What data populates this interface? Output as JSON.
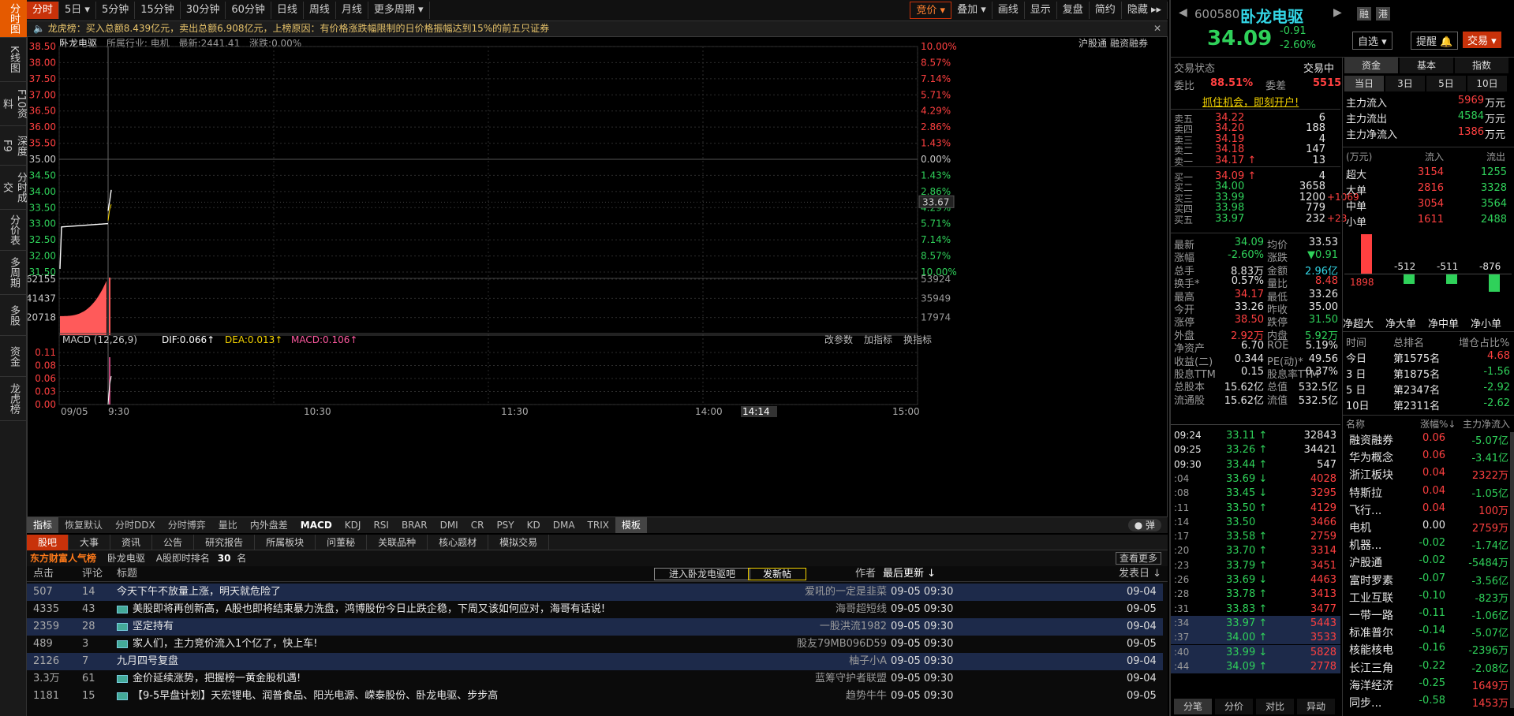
{
  "left_tabs": [
    "分时图",
    "K线图",
    "F10资料",
    "深度F9",
    "分时成交",
    "分价表",
    "多周期",
    "多股",
    "资金",
    "龙虎榜"
  ],
  "toolbar": {
    "items": [
      "分时",
      "5日",
      "5分钟",
      "15分钟",
      "30分钟",
      "60分钟",
      "日线",
      "周线",
      "月线",
      "更多周期"
    ],
    "right_items": [
      "竞价",
      "叠加",
      "画线",
      "显示",
      "复盘",
      "简约",
      "隐藏"
    ]
  },
  "notice": "龙虎榜：买入总额8.439亿元，卖出总额6.908亿元，上榜原因：有价格涨跌幅限制的日价格振幅达到15%的前五只证券",
  "chart_header": {
    "name": "卧龙电驱",
    "industry_label": "所属行业: 电机",
    "latest_label": "最新:2441.41",
    "change_label": "涨跌:0.00%",
    "right1": "沪股通",
    "right2": "融资融券"
  },
  "price_axis": {
    "left": [
      "38.50",
      "38.00",
      "37.50",
      "37.00",
      "36.50",
      "36.00",
      "35.50",
      "35.00",
      "34.50",
      "34.00",
      "33.50",
      "33.00",
      "32.50",
      "32.00",
      "31.50"
    ],
    "right": [
      "10.00%",
      "8.57%",
      "7.14%",
      "5.71%",
      "4.29%",
      "2.86%",
      "1.43%",
      "0.00%",
      "1.43%",
      "2.86%",
      "4.29%",
      "5.71%",
      "7.14%",
      "8.57%",
      "10.00%"
    ],
    "current_marker": "33.67"
  },
  "volume_axis": {
    "left": [
      "62155",
      "41437",
      "20718"
    ],
    "right": [
      "53924",
      "35949",
      "17974"
    ]
  },
  "macd": {
    "label": "MACD (12,26,9)",
    "dif": "DIF:0.066",
    "dea": "DEA:0.013",
    "macd": "MACD:0.106",
    "buttons": [
      "改参数",
      "加指标",
      "换指标"
    ],
    "axis": [
      "0.11",
      "0.08",
      "0.06",
      "0.03",
      "0.00"
    ]
  },
  "time_axis": [
    "09/05",
    "9:30",
    "10:30",
    "11:30",
    "14:00",
    "14:14",
    "15:00"
  ],
  "indicator_tabs": [
    "指标",
    "恢复默认",
    "分时DDX",
    "分时博弈",
    "量比",
    "内外盘差",
    "MACD",
    "KDJ",
    "RSI",
    "BRAR",
    "DMI",
    "CR",
    "PSY",
    "KD",
    "DMA",
    "TRIX",
    "模板"
  ],
  "popup_btn": "弹",
  "bottom_tabs": [
    "股吧",
    "大事",
    "资讯",
    "公告",
    "研究报告",
    "所属板块",
    "问董秘",
    "关联品种",
    "核心题材",
    "模拟交易"
  ],
  "rank_bar": {
    "brand": "东方财富人气榜",
    "name": "卧龙电驱",
    "rank_label": "A股即时排名",
    "rank": "30",
    "rank_unit": "名",
    "more": "查看更多"
  },
  "forum_header": {
    "clicks": "点击",
    "comments": "评论",
    "title": "标题",
    "enter": "进入卧龙电驱吧",
    "post": "发新帖",
    "author": "作者",
    "last": "最后更新",
    "posted": "发表日"
  },
  "forum_rows": [
    {
      "clicks": "507",
      "comments": "14",
      "title": "今天下午不放量上涨，明天就危险了",
      "author": "爱吼的一定是韭菜",
      "last": "09-05 09:30",
      "posted": "09-04",
      "hl": true,
      "icon": false
    },
    {
      "clicks": "4335",
      "comments": "43",
      "title": "美股即将再创新高，A股也即将结束暴力洗盘，鸿博股份今日止跌企稳，下周又该如何应对，海哥有话说!",
      "author": "海哥超短线",
      "last": "09-05 09:30",
      "posted": "09-05",
      "hl": false,
      "icon": true
    },
    {
      "clicks": "2359",
      "comments": "28",
      "title": "坚定持有",
      "author": "一股洪流1982",
      "last": "09-05 09:30",
      "posted": "09-04",
      "hl": true,
      "icon": true
    },
    {
      "clicks": "489",
      "comments": "3",
      "title": "家人们，主力竞价流入1个亿了，快上车!",
      "author": "股友79MB096D59",
      "last": "09-05 09:30",
      "posted": "09-05",
      "hl": false,
      "icon": true
    },
    {
      "clicks": "2126",
      "comments": "7",
      "title": "九月四号复盘",
      "author": "柚子小A",
      "last": "09-05 09:30",
      "posted": "09-04",
      "hl": true,
      "icon": false
    },
    {
      "clicks": "3.3万",
      "comments": "61",
      "title": "金价延续涨势，把握榜一黄金股机遇!",
      "author": "蓝筹守护者联盟",
      "last": "09-05 09:30",
      "posted": "09-04",
      "hl": false,
      "icon": true
    },
    {
      "clicks": "1181",
      "comments": "15",
      "title": "【9-5早盘计划】天宏锂电、润普食品、阳光电源、嵘泰股份、卧龙电驱、步步高",
      "author": "趋势牛牛",
      "last": "09-05 09:30",
      "posted": "09-05",
      "hl": false,
      "icon": true
    }
  ],
  "stock": {
    "code": "600580",
    "name": "卧龙电驱",
    "price": "34.09",
    "change": "-0.91",
    "pct": "-2.60%",
    "badges": [
      "融",
      "港"
    ],
    "select": "自选",
    "alert": "提醒",
    "trade": "交易"
  },
  "status": {
    "label": "交易状态",
    "value": "交易中",
    "weibi_label": "委比",
    "weibi": "88.51%",
    "weicha_label": "委差",
    "weicha": "5515",
    "promo": "抓住机会，即刻开户!"
  },
  "asks": [
    {
      "l": "卖五",
      "p": "34.22",
      "v": "6"
    },
    {
      "l": "卖四",
      "p": "34.20",
      "v": "188"
    },
    {
      "l": "卖三",
      "p": "34.19",
      "v": "4"
    },
    {
      "l": "卖二",
      "p": "34.18",
      "v": "147"
    },
    {
      "l": "卖一",
      "p": "34.17",
      "v": "13",
      "arrow": "↑"
    }
  ],
  "bids": [
    {
      "l": "买一",
      "p": "34.09",
      "v": "4",
      "arrow": "↑"
    },
    {
      "l": "买二",
      "p": "34.00",
      "v": "3658"
    },
    {
      "l": "买三",
      "p": "33.99",
      "v": "1200",
      "d": "+1069"
    },
    {
      "l": "买四",
      "p": "33.98",
      "v": "779"
    },
    {
      "l": "买五",
      "p": "33.97",
      "v": "232",
      "d": "+23"
    }
  ],
  "stats": [
    [
      "最新",
      "34.09",
      "均价",
      "33.53"
    ],
    [
      "涨幅",
      "-2.60%",
      "涨跌",
      "▼0.91"
    ],
    [
      "总手",
      "8.83万",
      "金额",
      "2.96亿"
    ],
    [
      "换手*",
      "0.57%",
      "量比",
      "8.48"
    ],
    [
      "最高",
      "34.17",
      "最低",
      "33.26"
    ],
    [
      "今开",
      "33.26",
      "昨收",
      "35.00"
    ],
    [
      "涨停",
      "38.50",
      "跌停",
      "31.50"
    ],
    [
      "外盘",
      "2.92万",
      "内盘",
      "5.92万"
    ],
    [
      "净资产",
      "6.70",
      "ROE",
      "5.19%"
    ],
    [
      "收益(二)",
      "0.344",
      "PE(动)*",
      "49.56"
    ],
    [
      "股息TTM",
      "0.15",
      "股息率TTM",
      "0.37%"
    ],
    [
      "总股本",
      "15.62亿",
      "总值",
      "532.5亿"
    ],
    [
      "流通股",
      "15.62亿",
      "流值",
      "532.5亿"
    ]
  ],
  "ticks": [
    {
      "t": "09:24",
      "p": "33.11",
      "v": "32843",
      "a": "↑"
    },
    {
      "t": "09:25",
      "p": "33.26",
      "v": "34421",
      "a": "↑"
    },
    {
      "t": "09:30",
      "p": "33.44",
      "v": "547",
      "a": "↑"
    },
    {
      "t": ":04",
      "p": "33.69",
      "v": "4028",
      "a": "↓"
    },
    {
      "t": ":08",
      "p": "33.45",
      "v": "3295",
      "a": "↓"
    },
    {
      "t": ":11",
      "p": "33.50",
      "v": "4129",
      "a": "↑"
    },
    {
      "t": ":14",
      "p": "33.50",
      "v": "3466",
      "a": ""
    },
    {
      "t": ":17",
      "p": "33.58",
      "v": "2759",
      "a": "↑"
    },
    {
      "t": ":20",
      "p": "33.70",
      "v": "3314",
      "a": "↑"
    },
    {
      "t": ":23",
      "p": "33.79",
      "v": "3451",
      "a": "↑"
    },
    {
      "t": ":26",
      "p": "33.69",
      "v": "4463",
      "a": "↓"
    },
    {
      "t": ":28",
      "p": "33.78",
      "v": "3413",
      "a": "↑"
    },
    {
      "t": ":31",
      "p": "33.83",
      "v": "3477",
      "a": "↑"
    },
    {
      "t": ":34",
      "p": "33.97",
      "v": "5443",
      "a": "↑"
    },
    {
      "t": ":37",
      "p": "34.00",
      "v": "3533",
      "a": "↑"
    },
    {
      "t": ":40",
      "p": "33.99",
      "v": "5828",
      "a": "↓"
    },
    {
      "t": ":44",
      "p": "34.09",
      "v": "2778",
      "a": "↑"
    }
  ],
  "tick_tabs": [
    "分笔",
    "分价",
    "对比",
    "异动"
  ],
  "fund": {
    "tabs": [
      "资金",
      "基本",
      "指数"
    ],
    "periods": [
      "当日",
      "3日",
      "5日",
      "10日"
    ],
    "inflow": [
      "主力流入",
      "5969万元"
    ],
    "outflow": [
      "主力流出",
      "4584万元"
    ],
    "net": [
      "主力净流入",
      "1386万元"
    ],
    "table_head": [
      "(万元)",
      "流入",
      "流出"
    ],
    "rows": [
      [
        "超大",
        "3154",
        "1255"
      ],
      [
        "大单",
        "2816",
        "3328"
      ],
      [
        "中单",
        "3054",
        "3564"
      ],
      [
        "小单",
        "1611",
        "2488"
      ]
    ],
    "bars": [
      1898,
      -512,
      -511,
      -876
    ],
    "bar_labels": [
      "净超大",
      "净大单",
      "净中单",
      "净小单"
    ]
  },
  "rank": {
    "head": [
      "时间",
      "总排名",
      "增仓占比%"
    ],
    "rows": [
      [
        "今日",
        "第1575名",
        "4.68"
      ],
      [
        "3 日",
        "第1875名",
        "-1.56"
      ],
      [
        "5 日",
        "第2347名",
        "-2.92"
      ],
      [
        "10日",
        "第2311名",
        "-2.62"
      ]
    ]
  },
  "sectors": {
    "head": [
      "名称",
      "涨幅%",
      "主力净流入"
    ],
    "rows": [
      [
        "融资融券",
        "0.06",
        "-5.07亿"
      ],
      [
        "华为概念",
        "0.06",
        "-3.41亿"
      ],
      [
        "浙江板块",
        "0.04",
        "2322万"
      ],
      [
        "特斯拉",
        "0.04",
        "-1.05亿"
      ],
      [
        "飞行...",
        "0.04",
        "100万"
      ],
      [
        "电机",
        "0.00",
        "2759万"
      ],
      [
        "机器...",
        "-0.02",
        "-1.74亿"
      ],
      [
        "沪股通",
        "-0.02",
        "-5484万"
      ],
      [
        "富时罗素",
        "-0.07",
        "-3.56亿"
      ],
      [
        "工业互联",
        "-0.10",
        "-823万"
      ],
      [
        "一带一路",
        "-0.11",
        "-1.06亿"
      ],
      [
        "标准普尔",
        "-0.14",
        "-5.07亿"
      ],
      [
        "核能核电",
        "-0.16",
        "-2396万"
      ],
      [
        "长江三角",
        "-0.22",
        "-2.08亿"
      ],
      [
        "海洋经济",
        "-0.25",
        "1649万"
      ],
      [
        "同步...",
        "-0.58",
        "1453万"
      ]
    ]
  },
  "colors": {
    "up": "#ff4040",
    "down": "#2fd15a",
    "accent": "#c8320a",
    "price_line": "#ffffff",
    "avg_line": "#f5d400"
  }
}
